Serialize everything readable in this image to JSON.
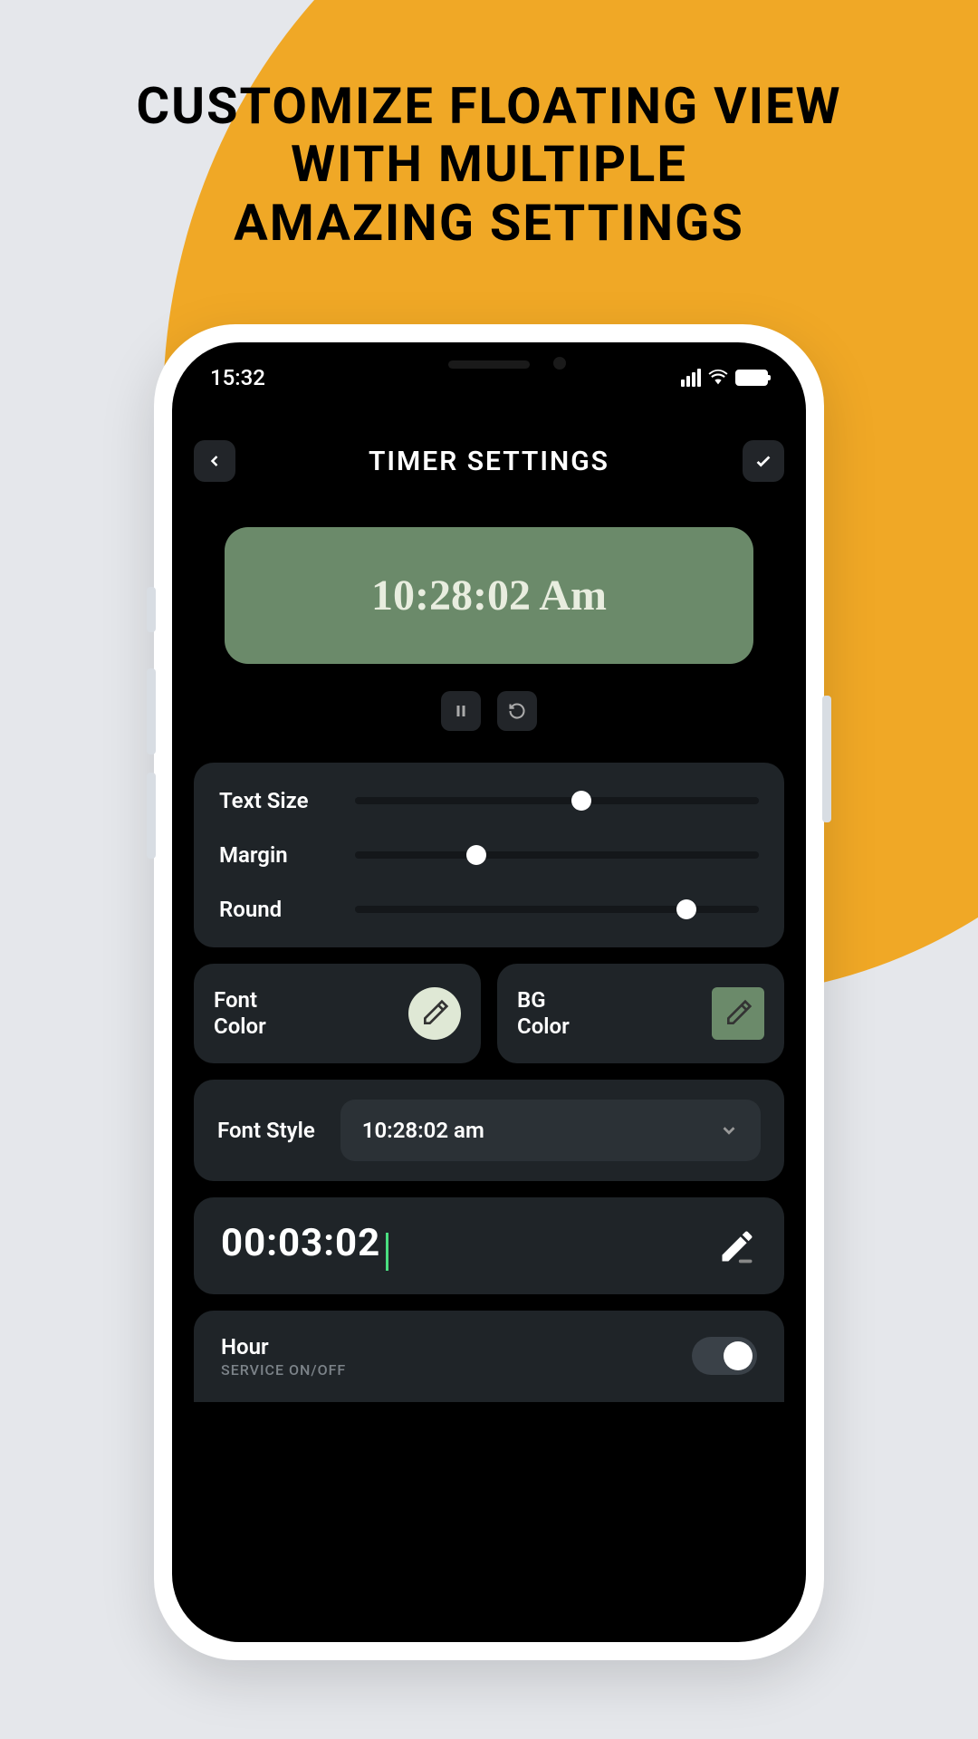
{
  "headline_l1": "CUSTOMIZE FLOATING VIEW",
  "headline_l2": "WITH MULTIPLE",
  "headline_l3": "AMAZING SETTINGS",
  "status": {
    "time": "15:32"
  },
  "header": {
    "title": "TIMER SETTINGS"
  },
  "preview": {
    "time": "10:28:02 Am"
  },
  "sliders": {
    "text_size": {
      "label": "Text Size",
      "value": 56
    },
    "margin": {
      "label": "Margin",
      "value": 30
    },
    "round": {
      "label": "Round",
      "value": 82
    }
  },
  "colors": {
    "font_label": "Font Color",
    "font_value": "#dfe8d5",
    "bg_label": "BG Color",
    "bg_value": "#6b8a6a"
  },
  "font_style": {
    "label": "Font Style",
    "selected": "10:28:02 am"
  },
  "timer": {
    "value": "00:03:02"
  },
  "hour": {
    "title": "Hour",
    "subtitle": "SERVICE ON/OFF",
    "on": true
  }
}
